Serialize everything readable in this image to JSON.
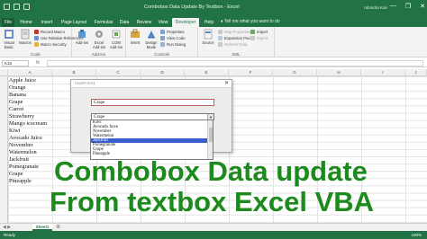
{
  "window": {
    "title": "Combobox Data Update By Textbox - Excel",
    "user": "rabindra Koir",
    "controls": [
      "—",
      "❐",
      "✕"
    ]
  },
  "tabs": [
    {
      "label": "File"
    },
    {
      "label": "Home"
    },
    {
      "label": "Insert"
    },
    {
      "label": "Page Layout"
    },
    {
      "label": "Formulas"
    },
    {
      "label": "Data"
    },
    {
      "label": "Review"
    },
    {
      "label": "View"
    },
    {
      "label": "Developer"
    },
    {
      "label": "Help"
    }
  ],
  "tell_me": "Tell me what you want to do",
  "ribbon": {
    "code": {
      "label": "Code",
      "visual_basic": "Visual Basic",
      "macros": "Macros",
      "record_macro": "Record Macro",
      "relative_refs": "Use Relative References",
      "macro_security": "Macro Security"
    },
    "addins": {
      "label": "Add-ins",
      "addins": "Add-ins",
      "excel_addins": "Excel Add-ins",
      "com_addins": "COM Add-ins"
    },
    "controls": {
      "label": "Controls",
      "insert": "Insert",
      "design_mode": "Design Mode",
      "properties": "Properties",
      "view_code": "View Code",
      "run_dialog": "Run Dialog"
    },
    "xml": {
      "label": "XML",
      "source": "Source",
      "map_properties": "Map Properties",
      "expansion_packs": "Expansion Packs",
      "refresh_data": "Refresh Data",
      "import": "Import",
      "export": "Export"
    }
  },
  "formula_bar": {
    "name_box": "K15",
    "fx": "fx",
    "value": ""
  },
  "columns": [
    "A",
    "B",
    "C",
    "D",
    "E",
    "F",
    "G",
    "H",
    "I",
    "J"
  ],
  "fruits": [
    "Apple Juice",
    "Orange",
    "Banana",
    "Grape",
    "Carrot",
    "Strawberry",
    "Mango icecream",
    "Kiwi",
    "Avocado Juice",
    "November",
    "Watermelon",
    "Jackfruit",
    "Pomegranate",
    "Grape",
    "Pineapple"
  ],
  "dialog": {
    "title": "UserForm1",
    "close": "✕",
    "textbox_value": "Grape",
    "combo_value": "Grape",
    "dropdown_items": [
      "Kiwi",
      "Avocado Juice",
      "November",
      "Watermelon",
      "Jackfruit",
      "Pomegranate",
      "Grape",
      "Pineapple"
    ],
    "selected_index": 4
  },
  "overlay": {
    "line1": "Combobox Data update",
    "line2": "From textbox Excel VBA"
  },
  "sheets": {
    "active": "Sheet1"
  },
  "status": {
    "ready": "Ready",
    "zoom": "100%"
  },
  "colors": {
    "excel_green": "#217346",
    "overlay_green": "#1d8a1d",
    "selection_blue": "#3a5fcd"
  }
}
